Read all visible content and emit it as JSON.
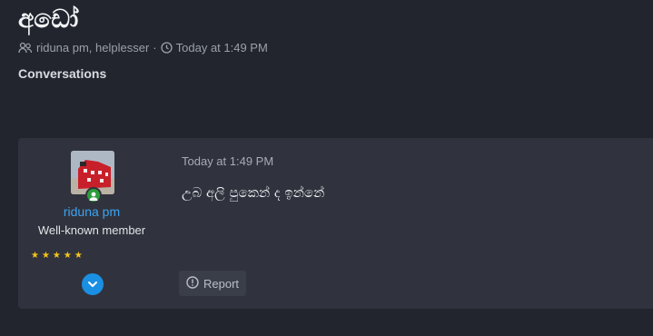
{
  "thread": {
    "title": "අඩෝ",
    "participants": "riduna pm, helplesser",
    "separator": "·",
    "time": "Today at 1:49 PM"
  },
  "breadcrumb": {
    "label": "Conversations"
  },
  "message": {
    "author": {
      "name": "riduna pm",
      "title": "Well-known member",
      "rating_stars": 5,
      "stars_text": "★★★★★",
      "online": true
    },
    "date": "Today at 1:49 PM",
    "body": "උබ අලි පුකෙන් ද ඉන්නේ",
    "report_label": "Report"
  },
  "colors": {
    "background": "#22252e",
    "card": "#30333d",
    "link": "#3ea3f2",
    "star": "#f5c518",
    "online": "#2d9d3a",
    "expand_button": "#1b8fe3"
  },
  "icons": [
    "users-icon",
    "clock-icon",
    "chevron-down-icon",
    "report-icon",
    "star-icon"
  ]
}
